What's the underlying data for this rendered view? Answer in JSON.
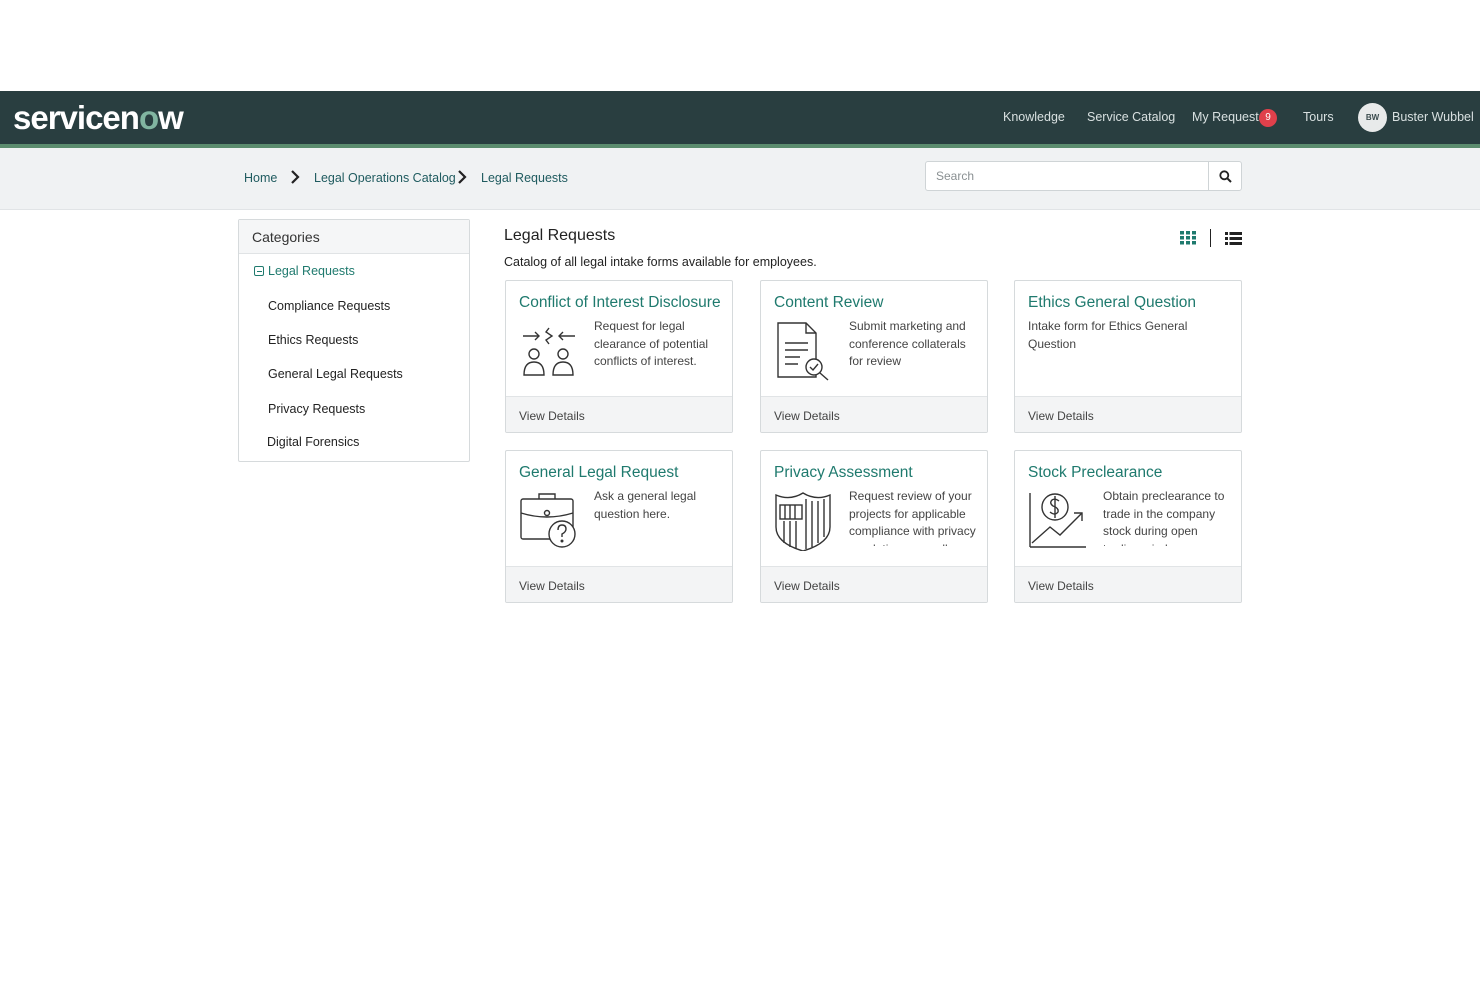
{
  "header": {
    "logo_text": "servicenow",
    "nav": {
      "knowledge": "Knowledge",
      "service_catalog": "Service Catalog",
      "my_requests": "My Requests",
      "my_requests_count": "9",
      "tours": "Tours"
    },
    "user": {
      "initials": "BW",
      "name": "Buster Wubbel"
    },
    "colors": {
      "bar": "#293e40",
      "accent": "#5b8c6e",
      "badge": "#e0404b"
    }
  },
  "breadcrumb": {
    "items": [
      "Home",
      "Legal Operations Catalog",
      "Legal Requests"
    ]
  },
  "search": {
    "placeholder": "Search",
    "value": ""
  },
  "categories": {
    "title": "Categories",
    "root": "Legal Requests",
    "items": [
      "Compliance Requests",
      "Ethics Requests",
      "General Legal Requests",
      "Privacy Requests",
      "Digital Forensics"
    ]
  },
  "main": {
    "title": "Legal Requests",
    "description": "Catalog of all legal intake forms available for employees.",
    "view_modes": [
      "grid-view-icon",
      "list-view-icon"
    ],
    "cards": [
      {
        "title": "Conflict of Interest Disclosure",
        "description": "Request for legal clearance of potential conflicts of interest.",
        "icon": "people-conflict-icon",
        "footer": "View Details"
      },
      {
        "title": "Content Review",
        "description": "Submit marketing and conference collaterals for review",
        "icon": "document-search-icon",
        "footer": "View Details"
      },
      {
        "title": "Ethics General Question",
        "description": "Intake form for Ethics General Question",
        "icon": "",
        "footer": "View Details"
      },
      {
        "title": "General Legal Request",
        "description": "Ask a general legal question here.",
        "icon": "briefcase-question-icon",
        "footer": "View Details"
      },
      {
        "title": "Privacy Assessment",
        "description": "Request review of your projects for applicable compliance with privacy regulations as well as",
        "icon": "shield-icon",
        "footer": "View Details"
      },
      {
        "title": "Stock Preclearance",
        "description": "Obtain preclearance to trade in the company stock during open trading window",
        "icon": "dollar-chart-icon",
        "footer": "View Details"
      }
    ],
    "colors": {
      "link": "#1f7a6e"
    }
  }
}
